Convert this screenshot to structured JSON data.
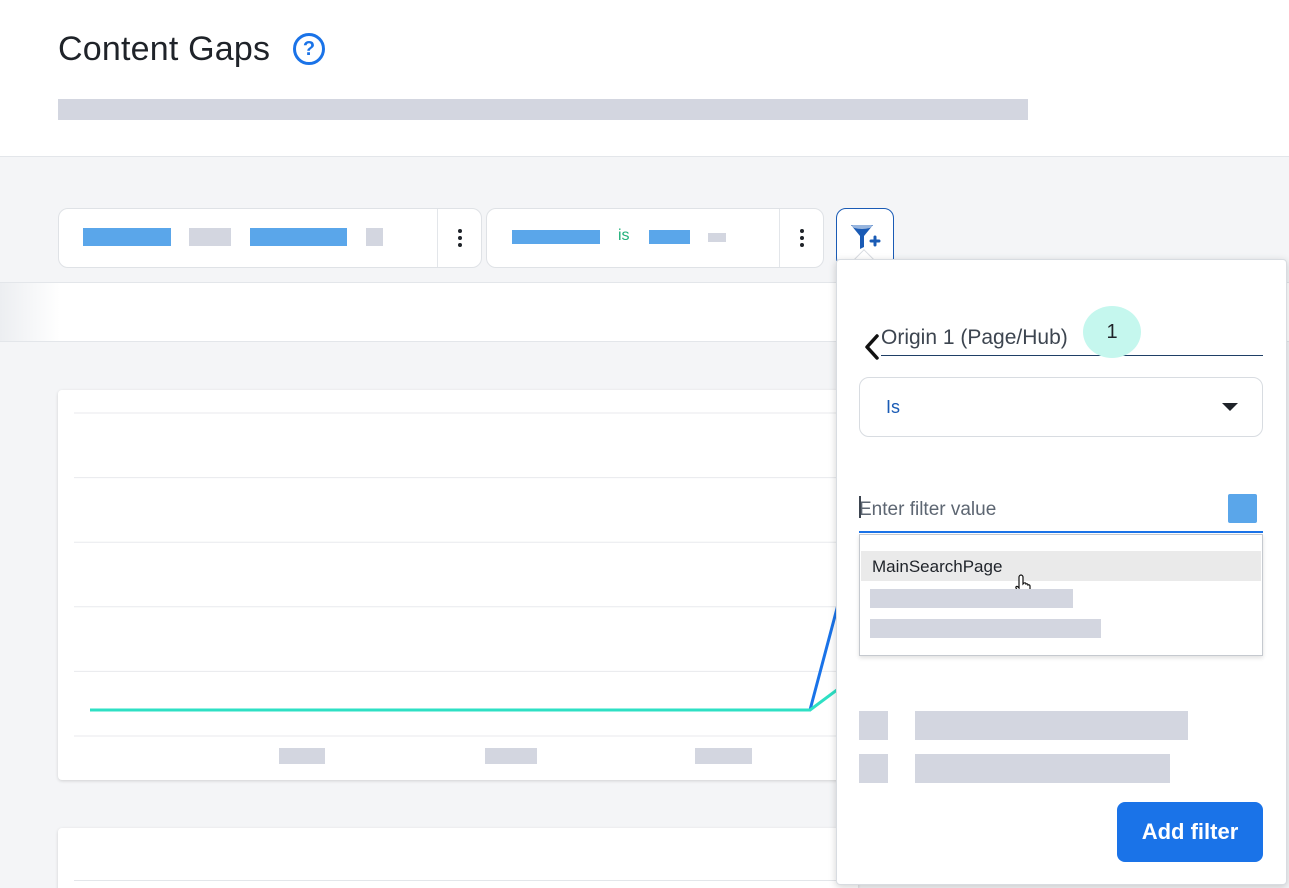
{
  "page": {
    "title": "Content Gaps",
    "help_icon": "question-circle-icon"
  },
  "filter_bar": {
    "chips": [
      {
        "operator_text": "",
        "menu_icon": "more-vertical-icon"
      },
      {
        "operator_text": "is",
        "menu_icon": "more-vertical-icon"
      }
    ],
    "add_filter_icon": "filter-plus-icon"
  },
  "chart_data": {
    "type": "line",
    "title": "",
    "xlabel": "",
    "ylabel": "",
    "grid": true,
    "series": [
      {
        "color": "#1a73e8",
        "values": [
          0,
          0,
          0,
          0,
          0,
          0,
          0,
          0,
          0,
          0,
          0,
          0.86,
          0.6
        ]
      },
      {
        "color": "#2ee0c4",
        "values": [
          0,
          0,
          0,
          0,
          0,
          0,
          0,
          0,
          0,
          0,
          0,
          0.17,
          0.12
        ]
      }
    ]
  },
  "filter_popup": {
    "field_name": "Origin 1 (Page/Hub)",
    "step_number": "1",
    "back_icon": "chevron-left-icon",
    "operator": {
      "selected": "Is",
      "icon": "caret-down-icon"
    },
    "value_input": {
      "value": "",
      "placeholder": "Enter filter value"
    },
    "options": [
      {
        "label": "MainSearchPage"
      }
    ],
    "submit_label": "Add filter"
  },
  "colors": {
    "accent": "#1a73e8",
    "teal": "#2ee0c4",
    "skeleton": "#d3d6e0",
    "skeleton_blue": "#5aa6ea",
    "is_green": "#21b07a",
    "badge": "#c5f7ee"
  }
}
